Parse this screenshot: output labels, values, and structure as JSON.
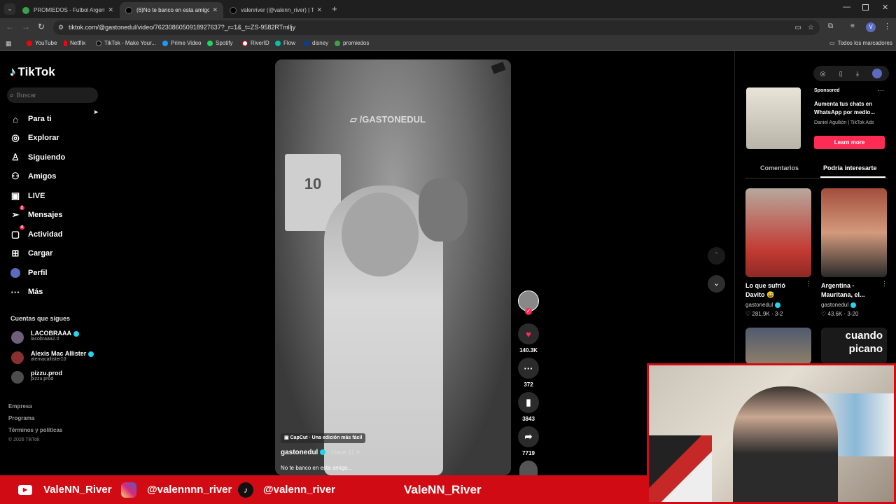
{
  "browser": {
    "tabs": [
      {
        "title": "PROMIEDOS - Futbol Argentino",
        "active": false
      },
      {
        "title": "(6)No te banco en esta amigo...",
        "active": true
      },
      {
        "title": "valenriver (@valenn_river) | TikTok",
        "active": false
      }
    ],
    "url": "tiktok.com/@gastonedul/video/7623086050918927637?_r=1&_t=ZS-9582RTmlljy",
    "bookmarks": [
      "YouTube",
      "Netflix",
      "TikTok - Make Your...",
      "Prime Video",
      "Spotify",
      "RiverID",
      "Flow",
      "disney",
      "promiedos"
    ],
    "all_bookmarks": "Todos los marcadores",
    "profile_initial": "V"
  },
  "sidebar": {
    "logo": "TikTok",
    "search_placeholder": "Buscar",
    "nav": [
      {
        "label": "Para ti",
        "icon": "home-icon",
        "badge": ""
      },
      {
        "label": "Explorar",
        "icon": "compass-icon",
        "badge": ""
      },
      {
        "label": "Siguiendo",
        "icon": "following-icon",
        "badge": ""
      },
      {
        "label": "Amigos",
        "icon": "friends-icon",
        "badge": ""
      },
      {
        "label": "LIVE",
        "icon": "live-icon",
        "badge": ""
      },
      {
        "label": "Mensajes",
        "icon": "messages-icon",
        "badge": "2"
      },
      {
        "label": "Actividad",
        "icon": "activity-icon",
        "badge": "4"
      },
      {
        "label": "Cargar",
        "icon": "upload-icon",
        "badge": ""
      },
      {
        "label": "Perfil",
        "icon": "profile-icon",
        "badge": ""
      },
      {
        "label": "Más",
        "icon": "more-icon",
        "badge": ""
      }
    ],
    "following_title": "Cuentas que sigues",
    "following": [
      {
        "name": "LACOBRAAA",
        "handle": "lacobraaa2.0"
      },
      {
        "name": "Alexis Mac Allister",
        "handle": "alemacallister10"
      },
      {
        "name": "pizzu.prod",
        "handle": "pizzu.prod"
      }
    ],
    "footer": [
      "Empresa",
      "Programa",
      "Términos y políticas"
    ],
    "copyright": "© 2026 TikTok"
  },
  "video": {
    "watermark": "/GASTONEDUL",
    "capcut": "CapCut · Una edición más fácil",
    "author": "gastonedul",
    "time": "· Hace 11 h",
    "caption": "No te banco en esta amigo...",
    "likes": "140.3K",
    "comments": "372",
    "saves": "3843",
    "shares": "7719"
  },
  "right": {
    "sponsored": "Sponsored",
    "ad_title": "Aumenta tus chats en WhatsApp por medio...",
    "ad_author": "Daniel Agullión | TikTok Ads",
    "learn_more": "Learn more",
    "tab_comments": "Comentarios",
    "tab_interest": "Podría interesarte",
    "cards": [
      {
        "title": "Lo que sufrió Davito 😅",
        "author": "gastonedul",
        "likes": "281.9K",
        "date": "3-2"
      },
      {
        "title": "Argentina - Mauritana, el...",
        "author": "gastonedul",
        "likes": "43.6K",
        "date": "3-20"
      }
    ],
    "thumb4_text": "cuando picano"
  },
  "stream": {
    "youtube": "ValeNN_River",
    "instagram": "@valennnn_river",
    "tiktok": "@valenn_river",
    "center": "ValeNN_River"
  },
  "colors": {
    "accent": "#fe2c55",
    "stream_red": "#d10b14",
    "verified": "#20d5ec"
  }
}
